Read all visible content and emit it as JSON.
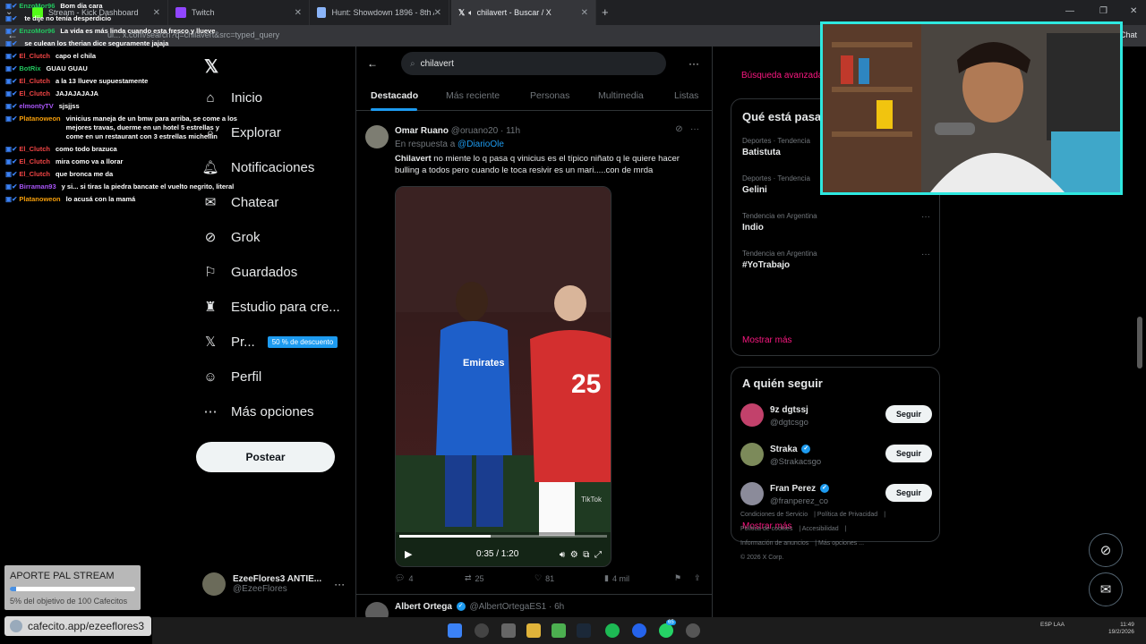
{
  "browser": {
    "tabs": [
      {
        "label": "Stream - Kick Dashboard"
      },
      {
        "label": "Twitch"
      },
      {
        "label": "Hunt: Showdown 1896 - 8th Anni"
      },
      {
        "label": "chilavert - Buscar / X"
      }
    ],
    "address": "ui... x.com/search?q=chilavert&src=typed_query",
    "chat_label": "Chat"
  },
  "chat": [
    {
      "user": "EnzoMor96",
      "color": "#22c55e",
      "msg": "Bom dia cara"
    },
    {
      "user": "",
      "color": "#22c55e",
      "msg": "te dije no tenía desperdicio"
    },
    {
      "user": "EnzoMor96",
      "color": "#22c55e",
      "msg": "La vida es más linda cuando esta fresco y llueve"
    },
    {
      "user": "",
      "color": "#a855f7",
      "msg": "se culean los therian dice seguramente jajaja"
    },
    {
      "user": "El_Clutch",
      "color": "#ef4444",
      "msg": "capo el chila"
    },
    {
      "user": "BotRix",
      "color": "#22c55e",
      "msg": "GUAU GUAU"
    },
    {
      "user": "El_Clutch",
      "color": "#ef4444",
      "msg": "a la 13 llueve supuestamente"
    },
    {
      "user": "El_Clutch",
      "color": "#ef4444",
      "msg": "JAJAJAJAJA"
    },
    {
      "user": "elmontyTV",
      "color": "#a855f7",
      "msg": "sjsjjss"
    },
    {
      "user": "Platanoweon",
      "color": "#f59e0b",
      "msg": "vinicius maneja de un bmw para arriba, se come a los mejores travas, duerme en un hotel 5 estrellas y come en un restaurant con 3 estrellas michellin"
    },
    {
      "user": "El_Clutch",
      "color": "#ef4444",
      "msg": "como todo brazuca"
    },
    {
      "user": "El_Clutch",
      "color": "#ef4444",
      "msg": "mira como va a llorar"
    },
    {
      "user": "El_Clutch",
      "color": "#ef4444",
      "msg": "que bronca me da"
    },
    {
      "user": "Birraman93",
      "color": "#a855f7",
      "msg": "y si... si tiras la piedra bancate el vuelto negrito, literal"
    },
    {
      "user": "Platanoweon",
      "color": "#f59e0b",
      "msg": "lo acusá con la mamá"
    }
  ],
  "nav": {
    "items": [
      {
        "label": "Inicio",
        "icon": "home-icon"
      },
      {
        "label": "Explorar",
        "icon": "search-icon"
      },
      {
        "label": "Notificaciones",
        "icon": "bell-icon"
      },
      {
        "label": "Chatear",
        "icon": "mail-icon"
      },
      {
        "label": "Grok",
        "icon": "grok-icon"
      },
      {
        "label": "Guardados",
        "icon": "bookmark-icon"
      },
      {
        "label": "Estudio para cre...",
        "icon": "studio-icon"
      },
      {
        "label": "Pr...",
        "icon": "x-premium-icon"
      },
      {
        "label": "Perfil",
        "icon": "person-icon"
      },
      {
        "label": "Más opciones",
        "icon": "more-circle-icon"
      }
    ],
    "promo_badge": "50 % de descuento",
    "post_label": "Postear",
    "profile_name": "EzeeFlores3 ANTIE...",
    "profile_handle": "@EzeeFlores"
  },
  "search": {
    "query": "chilavert",
    "tabs": [
      "Destacado",
      "Más reciente",
      "Personas",
      "Multimedia",
      "Listas"
    ],
    "active_tab": "Destacado"
  },
  "tweet": {
    "name": "Omar Ruano",
    "handle": "@oruano20",
    "time": "· 11h",
    "reply_prefix": "En respuesta a",
    "reply_mention": "@DiarioOle",
    "text_bold": "Chilavert",
    "text": " no miente lo q pasa q vinicius es el típico niñato q le quiere hacer bulling a todos pero cuando le toca resivir es un mari.....con de mrda",
    "video_time": "0:35 / 1:20",
    "video_progress": 0.44,
    "watermark": "TikTok",
    "replies": "4",
    "reposts": "25",
    "likes": "81",
    "views": "4 mil"
  },
  "tweet2": {
    "name": "Albert Ortega",
    "handle": "@AlbertOrtegaES1",
    "time": "· 6h"
  },
  "right": {
    "advanced_search": "Búsqueda avanzada",
    "trends_title": "Qué está pasando",
    "trends": [
      {
        "context": "Deportes · Tendencia",
        "title": "Batistuta"
      },
      {
        "context": "Deportes · Tendencia",
        "title": "Gelini"
      },
      {
        "context": "Tendencia en Argentina",
        "title": "Indio"
      },
      {
        "context": "Tendencia en Argentina",
        "title": "#YoTrabajo"
      }
    ],
    "show_more": "Mostrar más",
    "follow_title": "A quién seguir",
    "follow": [
      {
        "name": "9z dgtssj",
        "handle": "@dgtcsgo",
        "verified": false,
        "color": "#c2416b"
      },
      {
        "name": "Straka",
        "handle": "@Strakacsgo",
        "verified": true,
        "color": "#7c8a5a"
      },
      {
        "name": "Fran Perez",
        "handle": "@franperez_co",
        "verified": true,
        "color": "#8b8b9a"
      }
    ],
    "follow_btn": "Seguir",
    "footer": [
      "Condiciones de Servicio",
      "Política de Privacidad",
      "Política de cookies",
      "Accesibilidad",
      "Información de anuncios",
      "Más opciones ...",
      "© 2026 X Corp."
    ]
  },
  "overlay": {
    "aporte_title": "APORTE PAL STREAM",
    "aporte_progress": 0.05,
    "aporte_sub": "5% del objetivo de 100 Cafecitos",
    "link": "cafecito.app/ezeeflores3"
  },
  "taskbar": {
    "badge": "65",
    "lang": "ESP LAA",
    "clock_time": "11:49",
    "clock_date": "19/2/2026"
  },
  "colors": {
    "accent": "#1d9bf0",
    "pink": "#f91880",
    "webcam_border": "#2ee8e0"
  }
}
